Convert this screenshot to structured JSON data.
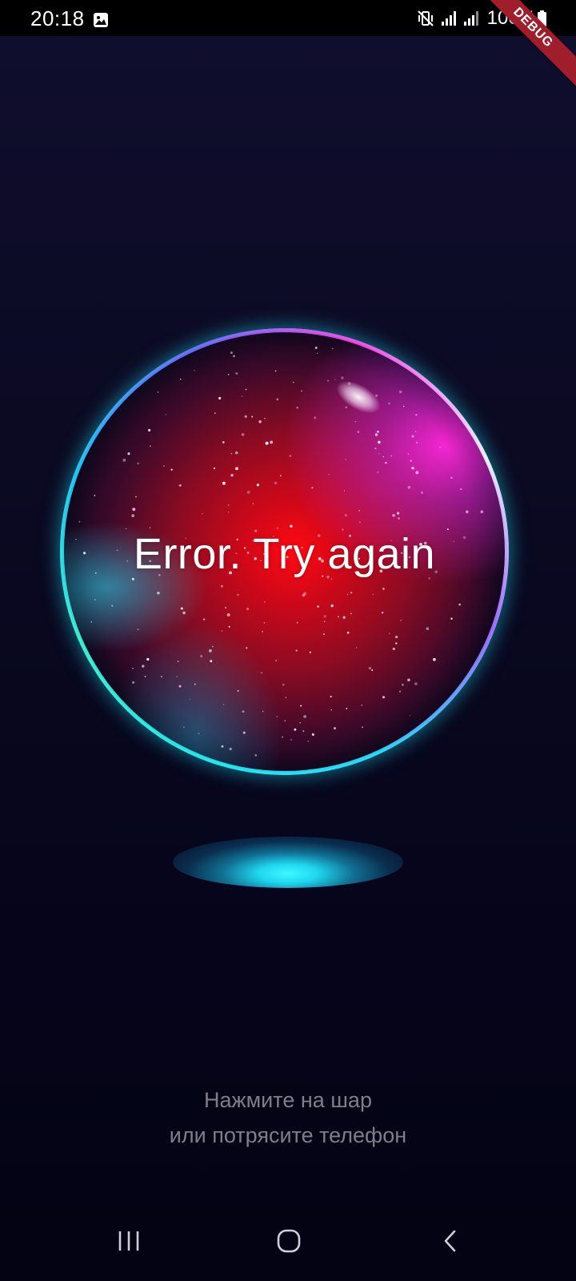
{
  "status_bar": {
    "time": "20:18",
    "battery_percent": "100%",
    "icons": [
      "gallery-icon",
      "mute-vibrate-icon",
      "signal-icon",
      "signal-icon",
      "battery-icon"
    ]
  },
  "debug_banner": "DEBUG",
  "orb": {
    "message": "Error. Try again",
    "colors": {
      "core": "#ff0a12",
      "rim": "#3ee9e2",
      "accent": "#ff46e8"
    }
  },
  "hint": {
    "line1": "Нажмите на шар",
    "line2": "или потрясите телефон"
  },
  "nav_bar": {
    "buttons": [
      "recents-icon",
      "home-icon",
      "back-icon"
    ]
  }
}
